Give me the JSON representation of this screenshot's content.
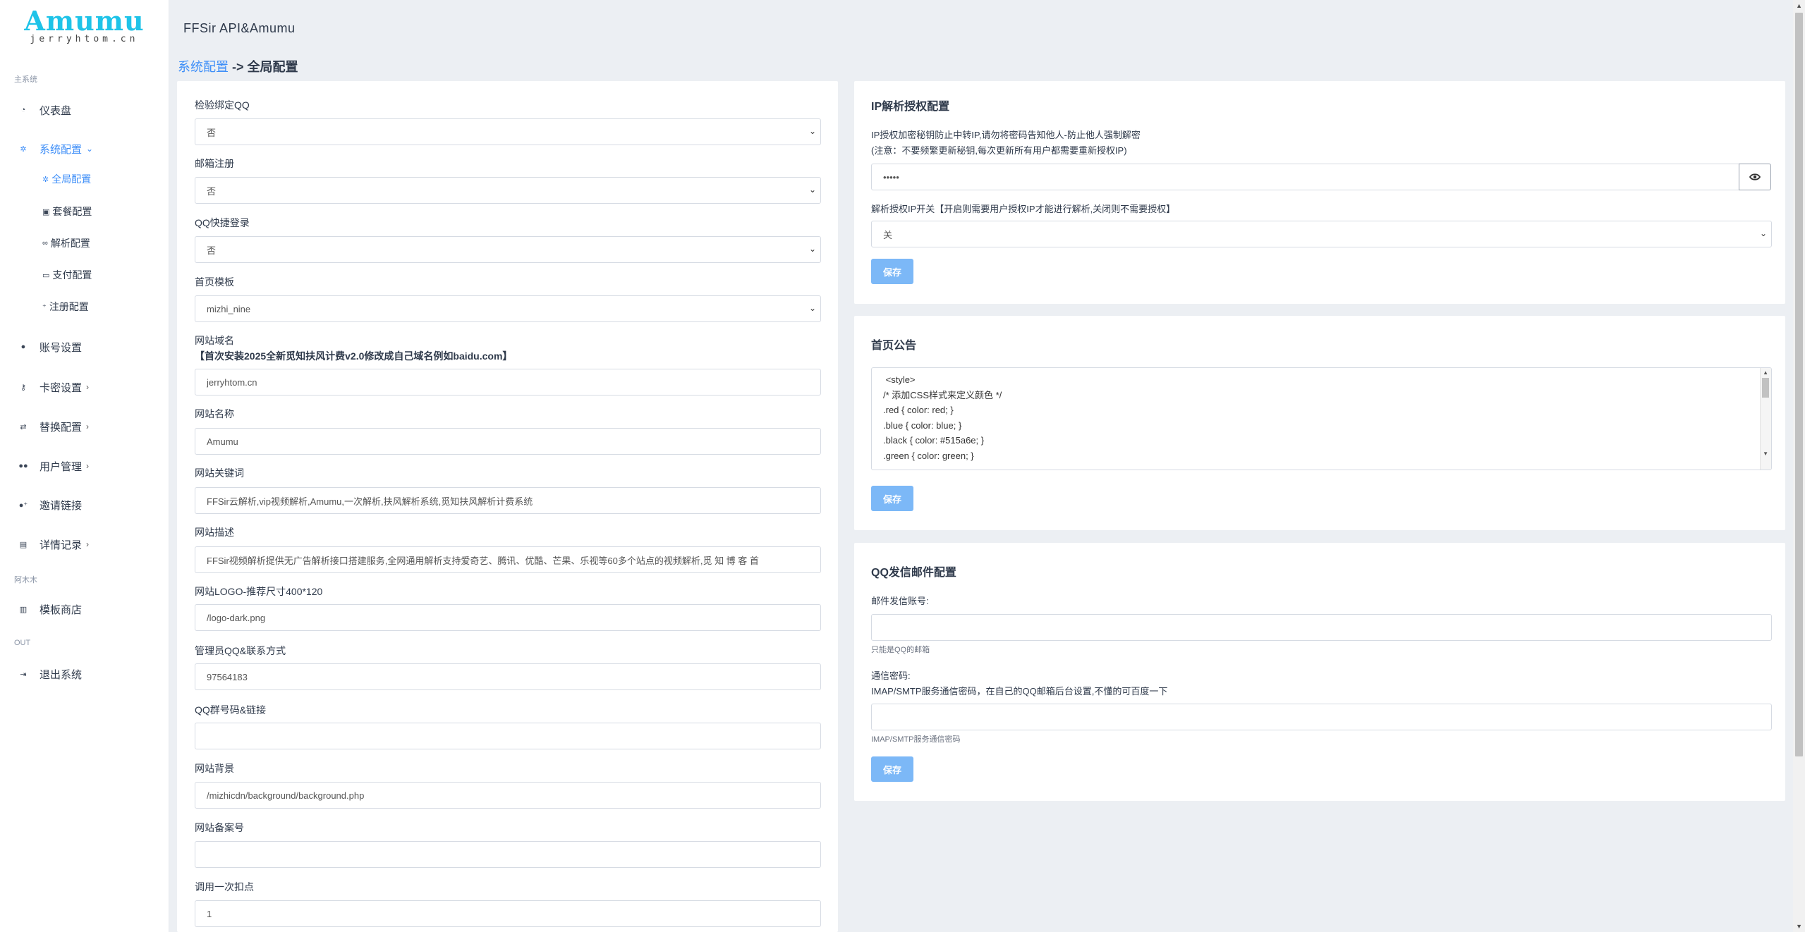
{
  "brand": {
    "logo": "Amumu",
    "sub": "jerryhtom.cn"
  },
  "sidebar": {
    "section_main": "主系统",
    "section_store": "阿木木",
    "section_out": "OUT",
    "items": [
      {
        "label": "仪表盘",
        "icon": "gauge-icon"
      },
      {
        "label": "系统配置",
        "icon": "gear-icon"
      },
      {
        "label": "账号设置",
        "icon": "user-icon"
      },
      {
        "label": "卡密设置",
        "icon": "key-icon"
      },
      {
        "label": "替换配置",
        "icon": "swap-icon"
      },
      {
        "label": "用户管理",
        "icon": "users-icon"
      },
      {
        "label": "邀请链接",
        "icon": "invite-icon"
      },
      {
        "label": "详情记录",
        "icon": "file-icon"
      },
      {
        "label": "模板商店",
        "icon": "store-icon"
      },
      {
        "label": "退出系统",
        "icon": "logout-icon"
      }
    ],
    "subitems": [
      {
        "label": "全局配置",
        "icon": "gear-icon"
      },
      {
        "label": "套餐配置",
        "icon": "package-icon"
      },
      {
        "label": "解析配置",
        "icon": "link-icon"
      },
      {
        "label": "支付配置",
        "icon": "card-icon"
      },
      {
        "label": "注册配置",
        "icon": "user-plus-icon"
      }
    ]
  },
  "header": {
    "title": "FFSir API&Amumu"
  },
  "breadcrumb": {
    "parent": "系统配置",
    "sep": " -> ",
    "current": "全局配置"
  },
  "left_form": {
    "qq_bind_label": "检验绑定QQ",
    "qq_bind_value": "否",
    "email_reg_label": "邮箱注册",
    "email_reg_value": "否",
    "qq_login_label": "QQ快捷登录",
    "qq_login_value": "否",
    "template_label": "首页模板",
    "template_value": "mizhi_nine",
    "domain_label": "网站域名",
    "domain_note": "【首次安装2025全新觅知扶风计费v2.0修改成自己域名例如baidu.com】",
    "domain_value": "jerryhtom.cn",
    "site_name_label": "网站名称",
    "site_name_value": "Amumu",
    "keywords_label": "网站关键词",
    "keywords_value": "FFSir云解析,vip视频解析,Amumu,一次解析,扶风解析系统,觅知扶风解析计费系统",
    "description_label": "网站描述",
    "description_value": "FFSir视频解析提供无广告解析接口搭建服务,全网通用解析支持爱奇艺、腾讯、优酷、芒果、乐视等60多个站点的视频解析,觅 知 博 客 首",
    "logo_label": "网站LOGO-推荐尺寸400*120",
    "logo_value": "/logo-dark.png",
    "admin_qq_label": "管理员QQ&联系方式",
    "admin_qq_value": "97564183",
    "qq_group_label": "QQ群号码&链接",
    "qq_group_value": "",
    "background_label": "网站背景",
    "background_value": "/mizhicdn/background/background.php",
    "icp_label": "网站备案号",
    "icp_value": "",
    "deduct_label": "调用一次扣点",
    "deduct_value": "1"
  },
  "ip_card": {
    "title": "IP解析授权配置",
    "desc1": "IP授权加密秘钥防止中转IP,请勿将密码告知他人-防止他人强制解密",
    "desc2": "(注意：不要频繁更新秘钥,每次更新所有用户都需要重新授权IP)",
    "secret_value": "•••••",
    "switch_label": "解析授权IP开关【开启则需要用户授权IP才能进行解析,关闭则不需要授权】",
    "switch_value": "关",
    "save": "保存"
  },
  "notice_card": {
    "title": "首页公告",
    "lines": [
      " <style>",
      "/* 添加CSS样式来定义颜色 */",
      ".red { color: red; }",
      ".blue { color: blue; }",
      ".black { color: #515a6e; }",
      ".green { color: green; }"
    ],
    "save": "保存"
  },
  "mail_card": {
    "title": "QQ发信邮件配置",
    "account_label": "邮件发信账号:",
    "account_value": "",
    "account_help": "只能是QQ的邮箱",
    "pass_label": "通信密码:",
    "pass_desc": "IMAP/SMTP服务通信密码，在自己的QQ邮箱后台设置,不懂的可百度一下",
    "pass_value": "",
    "pass_help": "IMAP/SMTP服务通信密码",
    "save": "保存"
  },
  "colors": {
    "accent": "#3d8ef8",
    "brand": "#1ec3e8",
    "button": "#7cb8f7"
  }
}
